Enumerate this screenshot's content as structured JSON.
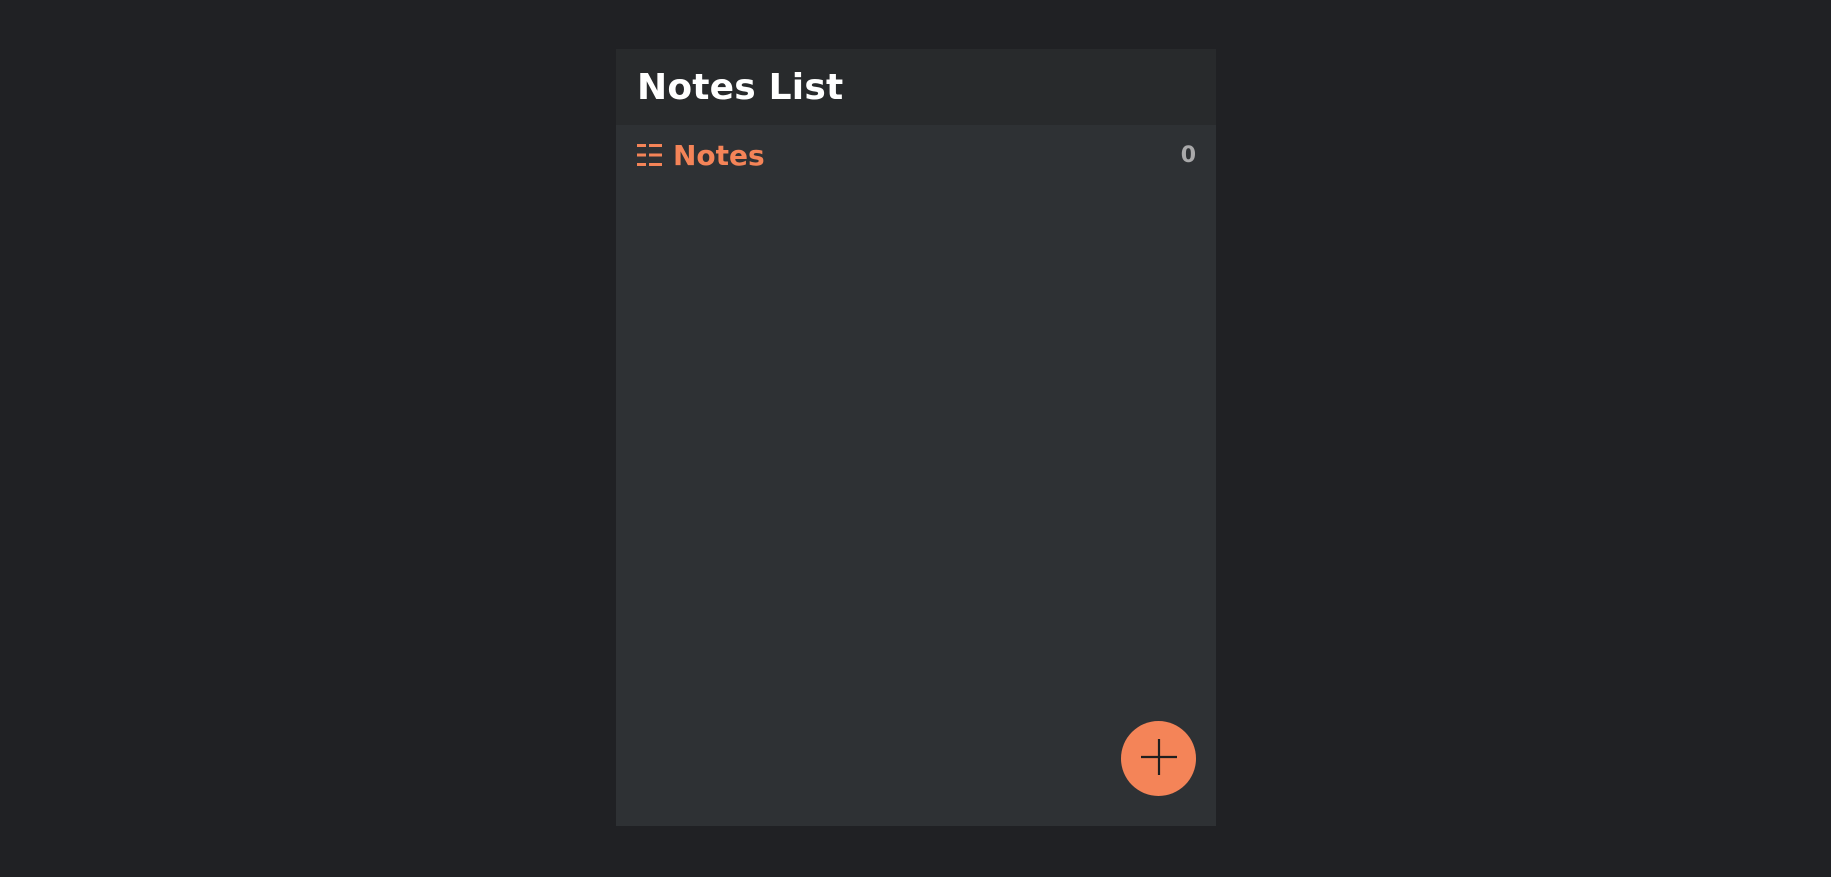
{
  "header": {
    "title": "Notes List"
  },
  "sections": [
    {
      "icon": "list-icon",
      "label": "Notes",
      "count": "0"
    }
  ],
  "fab": {
    "icon": "plus-icon"
  },
  "colors": {
    "background": "#202124",
    "panel": "#2e3134",
    "header": "#282a2c",
    "accent": "#f48458",
    "count": "#a9a9aa",
    "title": "#ffffff"
  }
}
